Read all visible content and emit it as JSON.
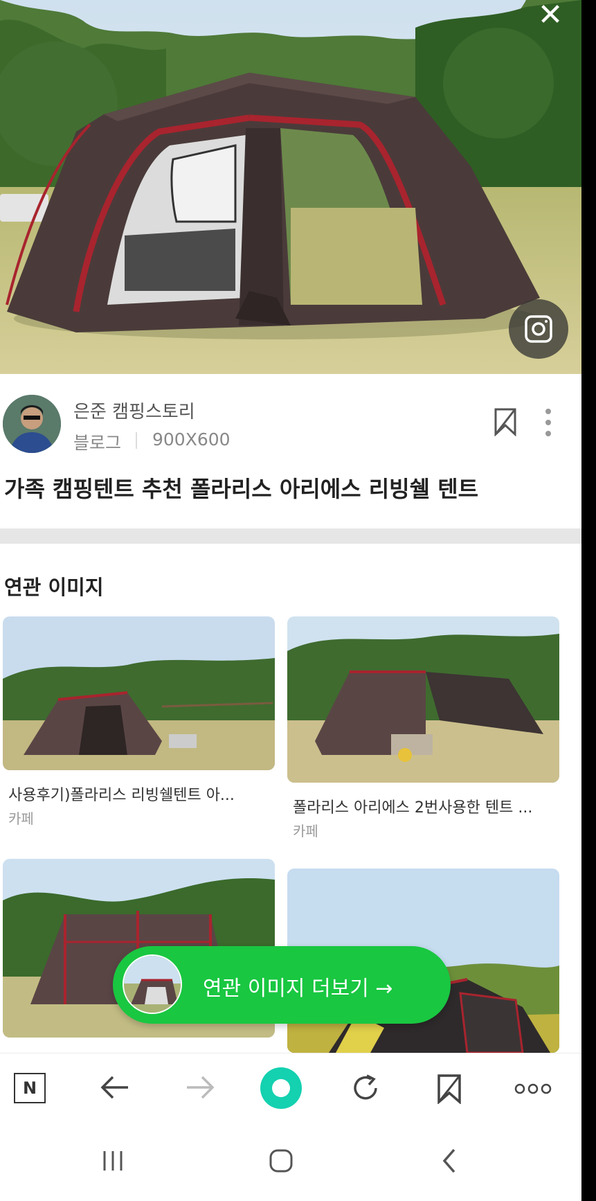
{
  "viewer": {
    "close_label": "✕"
  },
  "source": {
    "name": "은준 캠핑스토리",
    "type": "블로그",
    "size": "900X600"
  },
  "title": "가족 캠핑텐트 추천 폴라리스 아리에스 리빙쉘 텐트",
  "related": {
    "heading": "연관 이미지",
    "items": [
      {
        "title": "사용후기)폴라리스 리빙쉘텐트 아...",
        "source": "카페"
      },
      {
        "title": "폴라리스 아리에스 2번사용한 텐트 ...",
        "source": "카페"
      },
      {
        "title": "",
        "source": ""
      },
      {
        "title": "",
        "source": ""
      }
    ],
    "more_button": "연관 이미지 더보기 →"
  },
  "browser_nav": {
    "home": "N",
    "icons": [
      "naver-home-icon",
      "back-arrow-icon",
      "forward-arrow-icon",
      "green-dot-icon",
      "reload-icon",
      "bookmark-icon",
      "more-dots-icon"
    ]
  },
  "system_nav": {
    "icons": [
      "recent-apps-icon",
      "home-icon",
      "back-icon"
    ]
  },
  "colors": {
    "accent_green": "#19c741",
    "tent_brown": "#4a3b3a",
    "tent_red": "#a8242e"
  }
}
